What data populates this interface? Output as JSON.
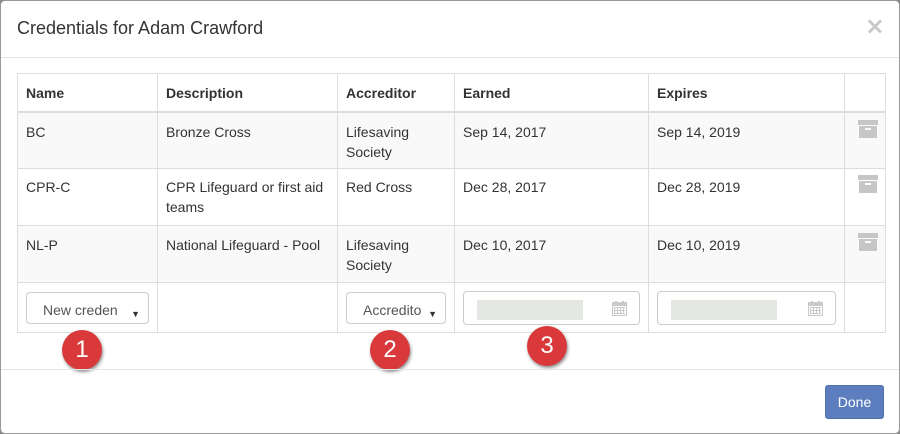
{
  "dialog": {
    "title": "Credentials for Adam Crawford",
    "close_symbol": "×"
  },
  "table": {
    "headers": [
      "Name",
      "Description",
      "Accreditor",
      "Earned",
      "Expires"
    ],
    "rows": [
      {
        "name": "BC",
        "description": "Bronze Cross",
        "accreditor": "Lifesaving Society",
        "earned": "Sep 14, 2017",
        "expires": "Sep 14, 2019",
        "action_icon": "archive-icon"
      },
      {
        "name": "CPR-C",
        "description": "CPR Lifeguard or first aid teams",
        "accreditor": "Red Cross",
        "earned": "Dec 28, 2017",
        "expires": "Dec 28, 2019",
        "action_icon": "archive-icon"
      },
      {
        "name": "NL-P",
        "description": "National Lifeguard - Pool",
        "accreditor": "Lifesaving Society",
        "earned": "Dec 10, 2017",
        "expires": "Dec 10, 2019",
        "action_icon": "archive-icon"
      }
    ],
    "new_row": {
      "credential_select": "New creden",
      "accreditor_select": "Accredito",
      "caret": "▼",
      "earned_icon": "calendar-icon",
      "expires_icon": "calendar-icon"
    }
  },
  "callouts": [
    "1",
    "2",
    "3"
  ],
  "footer": {
    "done_label": "Done"
  },
  "colors": {
    "badge": "#d9393a",
    "done_button": "#5c7ebf"
  }
}
